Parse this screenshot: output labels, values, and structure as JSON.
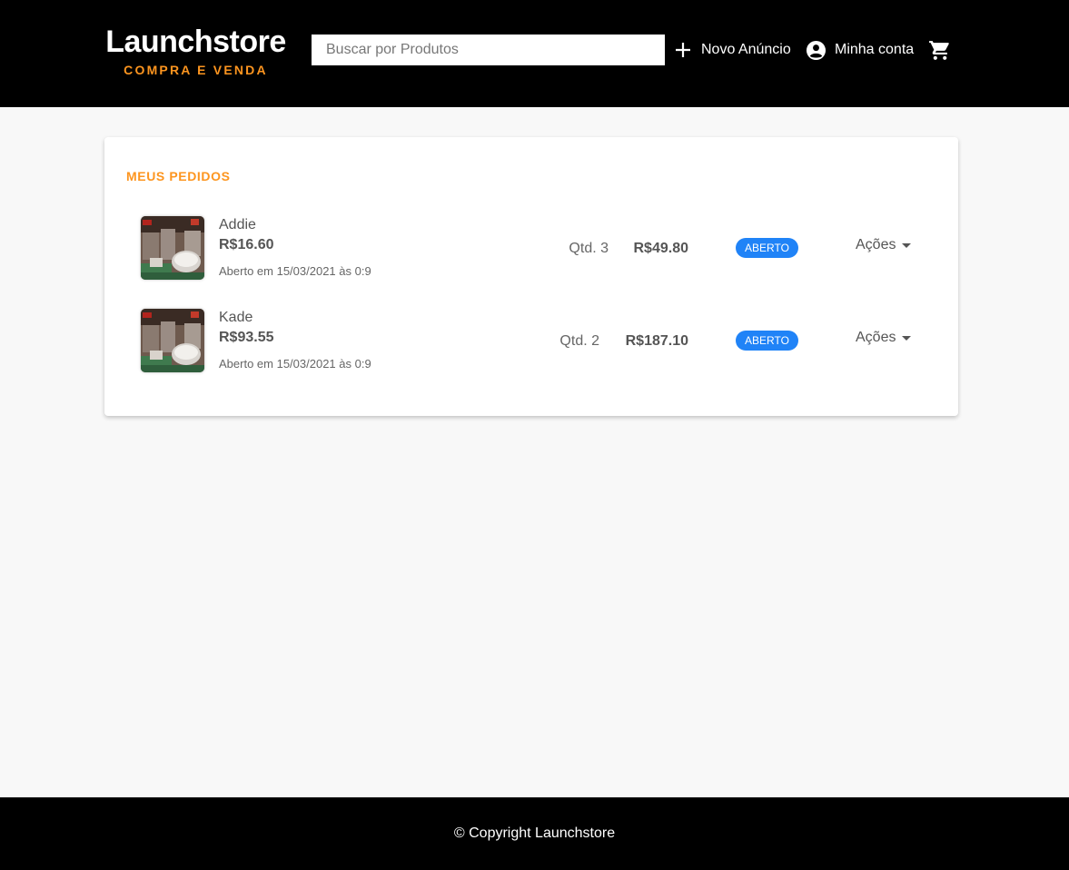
{
  "header": {
    "logo_title": "Launchstore",
    "logo_subtitle": "COMPRA E VENDA",
    "search_placeholder": "Buscar por Produtos",
    "new_listing_label": "Novo Anúncio",
    "account_label": "Minha conta",
    "icons": [
      "plus-icon",
      "account-circle-icon",
      "shopping-cart-icon"
    ]
  },
  "main": {
    "section_title": "MEUS PEDIDOS",
    "orders": [
      {
        "name": "Addie",
        "unit_price": "R$16.60",
        "date": "Aberto em 15/03/2021 às 0:9",
        "quantity": "Qtd. 3",
        "total": "R$49.80",
        "status": "ABERTO",
        "actions_label": "Ações"
      },
      {
        "name": "Kade",
        "unit_price": "R$93.55",
        "date": "Aberto em 15/03/2021 às 0:9",
        "quantity": "Qtd. 2",
        "total": "R$187.10",
        "status": "ABERTO",
        "actions_label": "Ações"
      }
    ]
  },
  "footer": {
    "copyright": "© Copyright Launchstore"
  },
  "colors": {
    "header_bg": "#000000",
    "accent": "#fd951f",
    "status_badge": "#2083f7",
    "page_bg": "#f8f8f8"
  }
}
